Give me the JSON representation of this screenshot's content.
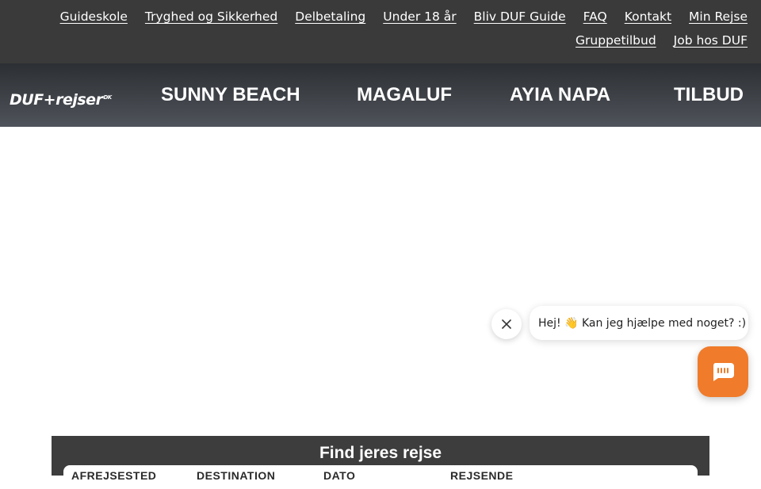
{
  "utility_nav": {
    "row1": [
      "Guideskole",
      "Tryghed og Sikkerhed",
      "Delbetaling",
      "Under 18 år",
      "Bliv DUF Guide",
      "FAQ",
      "Kontakt",
      "Min Rejse"
    ],
    "row2": [
      "Gruppetilbud",
      "Job hos DUF"
    ]
  },
  "logo": {
    "text": "DUF+rejser",
    "suffix": "DK"
  },
  "main_nav": [
    "SUNNY BEACH",
    "MAGALUF",
    "AYIA NAPA",
    "TILBUD"
  ],
  "chat": {
    "message": "Hej! 👋 Kan jeg hjælpe med noget? :)",
    "launcher_color": "#f07b2a",
    "close_icon": "close-icon",
    "launcher_icon": "chat-icon"
  },
  "search": {
    "title": "Find jeres rejse",
    "fields": [
      "AFREJSESTED",
      "DESTINATION",
      "DATO",
      "REJSENDE"
    ]
  },
  "colors": {
    "topbar": "#3a3a3a",
    "nav_gradient_top": "#2c2f33",
    "nav_gradient_bottom": "#4f535a",
    "search_panel": "#3d3d3d"
  }
}
